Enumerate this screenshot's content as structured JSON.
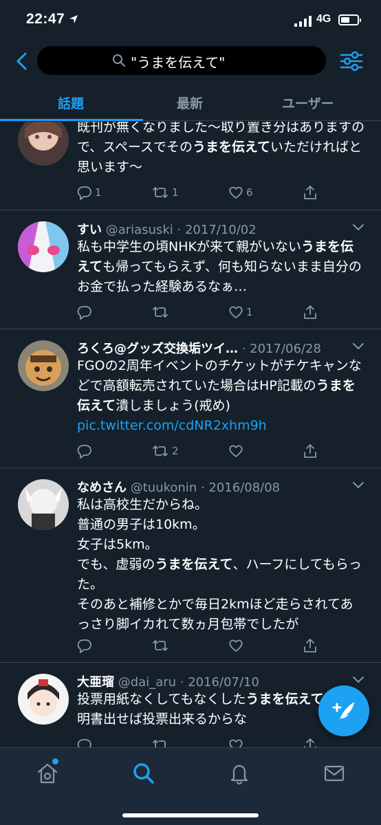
{
  "status": {
    "time": "22:47",
    "network": "4G"
  },
  "search": {
    "query": "\"うまを伝えて\""
  },
  "tabs": [
    {
      "label": "話題",
      "active": true
    },
    {
      "label": "最新",
      "active": false
    },
    {
      "label": "ユーザー",
      "active": false
    }
  ],
  "tweets": [
    {
      "name": "",
      "handle": "",
      "body_before": "既刊が無くなりました〜取り置き分はありますので、スペースでその",
      "highlight": "うまを伝えて",
      "body_after": "いただければと思います〜",
      "link": "",
      "replies": "1",
      "retweets": "1",
      "likes": "6"
    },
    {
      "name": "すい",
      "handle": "@ariasuski · 2017/10/02",
      "body_before": "私も中学生の頃NHKが来て親がいない",
      "highlight": "うまを伝えて",
      "body_after": "も帰ってもらえず、何も知らないまま自分のお金で払った経験あるなぁ…",
      "link": "",
      "replies": "",
      "retweets": "",
      "likes": "1"
    },
    {
      "name": "ろくろ@グッズ交換垢ツイ…",
      "handle": "· 2017/06/28",
      "body_before": "FGOの2周年イベントのチケットがチケキャンなどで高額転売されていた場合はHP記載の",
      "highlight": "うまを伝えて",
      "body_after": "潰しましょう(戒め)",
      "link": "pic.twitter.com/cdNR2xhm9h",
      "replies": "",
      "retweets": "2",
      "likes": ""
    },
    {
      "name": "なめさん",
      "handle": "@tuukonin · 2016/08/08",
      "body_before": "私は高校生だからね。\n普通の男子は10km。\n女子は5km。\nでも、虚弱の",
      "highlight": "うまを伝えて",
      "body_after": "、ハーフにしてもらった。\nそのあと補修とかで毎日2kmほど走らされてあっさり脚イカれて数ヵ月包帯でしたが",
      "link": "",
      "replies": "",
      "retweets": "",
      "likes": ""
    },
    {
      "name": "大亜瑠",
      "handle": "@dai_aru · 2016/07/10",
      "body_before": "投票用紙なくしてもなくした",
      "highlight": "うまを伝えて",
      "body_after": "身分証明書出せば投票出来るからな",
      "link": "",
      "replies": "",
      "retweets": "",
      "likes": ""
    }
  ],
  "colors": {
    "accent": "#1da1f2",
    "background": "#15202b",
    "muted": "#8899a6",
    "divider": "#38444d"
  },
  "icons": [
    "back-arrow-icon",
    "search-icon",
    "filter-icon",
    "reply-icon",
    "retweet-icon",
    "like-icon",
    "share-icon",
    "chevron-down-icon",
    "compose-icon",
    "home-icon",
    "notifications-icon",
    "messages-icon"
  ]
}
